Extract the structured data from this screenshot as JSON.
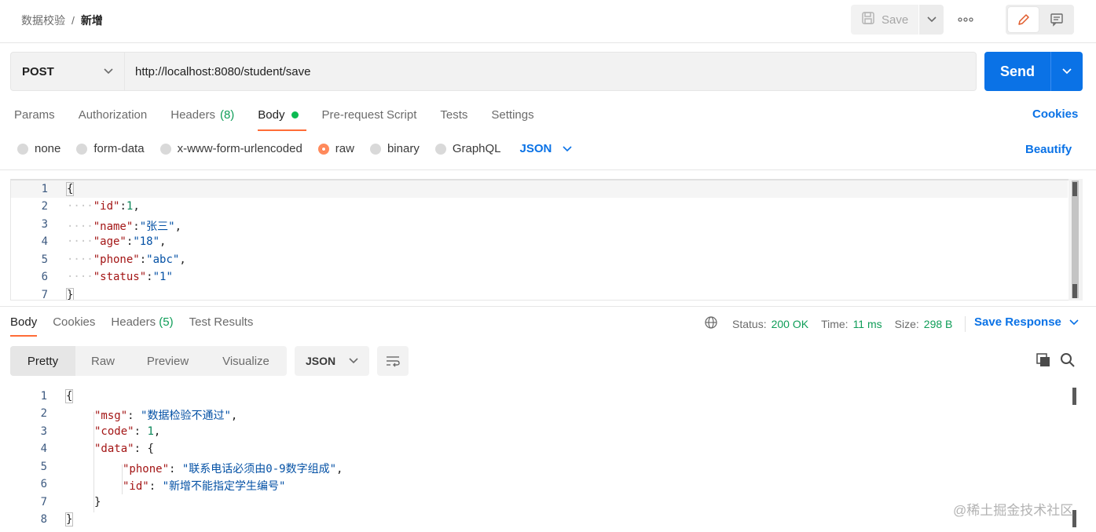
{
  "header": {
    "breadcrumb_parent": "数据校验",
    "breadcrumb_sep": "/",
    "breadcrumb_current": "新增",
    "save_label": "Save",
    "more_label": "ooo"
  },
  "request": {
    "method": "POST",
    "url": "http://localhost:8080/student/save",
    "send_label": "Send",
    "tabs": [
      {
        "label": "Params"
      },
      {
        "label": "Authorization"
      },
      {
        "label": "Headers",
        "count": "(8)"
      },
      {
        "label": "Body"
      },
      {
        "label": "Pre-request Script"
      },
      {
        "label": "Tests"
      },
      {
        "label": "Settings"
      }
    ],
    "cookies_label": "Cookies",
    "body_types": [
      "none",
      "form-data",
      "x-www-form-urlencoded",
      "raw",
      "binary",
      "GraphQL"
    ],
    "selected_body_type": "raw",
    "language": "JSON",
    "beautify_label": "Beautify",
    "line_numbers": [
      "1",
      "2",
      "3",
      "4",
      "5",
      "6",
      "7"
    ],
    "body_lines": {
      "l1": "{",
      "id_key": "\"id\"",
      "id_val": "1",
      "name_key": "\"name\"",
      "name_val": "\"张三\"",
      "age_key": "\"age\"",
      "age_val": "\"18\"",
      "phone_key": "\"phone\"",
      "phone_val": "\"abc\"",
      "status_key": "\"status\"",
      "status_val": "\"1\"",
      "l7": "}"
    }
  },
  "response": {
    "tabs": [
      {
        "label": "Body"
      },
      {
        "label": "Cookies"
      },
      {
        "label": "Headers",
        "count": "(5)"
      },
      {
        "label": "Test Results"
      }
    ],
    "status_label": "Status:",
    "status_value": "200 OK",
    "time_label": "Time:",
    "time_value": "11 ms",
    "size_label": "Size:",
    "size_value": "298 B",
    "save_response_label": "Save Response",
    "views": [
      "Pretty",
      "Raw",
      "Preview",
      "Visualize"
    ],
    "format": "JSON",
    "line_numbers": [
      "1",
      "2",
      "3",
      "4",
      "5",
      "6",
      "7",
      "8"
    ],
    "body": {
      "l1": "{",
      "msg_key": "\"msg\"",
      "msg_val": "\"数据检验不通过\"",
      "code_key": "\"code\"",
      "code_val": "1",
      "data_key": "\"data\"",
      "data_open": "{",
      "phone_key": "\"phone\"",
      "phone_val": "\"联系电话必须由0-9数字组成\"",
      "id_key": "\"id\"",
      "id_val": "\"新增不能指定学生编号\"",
      "data_close": "}",
      "l8": "}"
    }
  },
  "watermark": "@稀土掘金技术社区",
  "colors": {
    "accent_orange": "#ff6c37",
    "send_blue": "#0a72e6",
    "success_green": "#0f9d58"
  }
}
